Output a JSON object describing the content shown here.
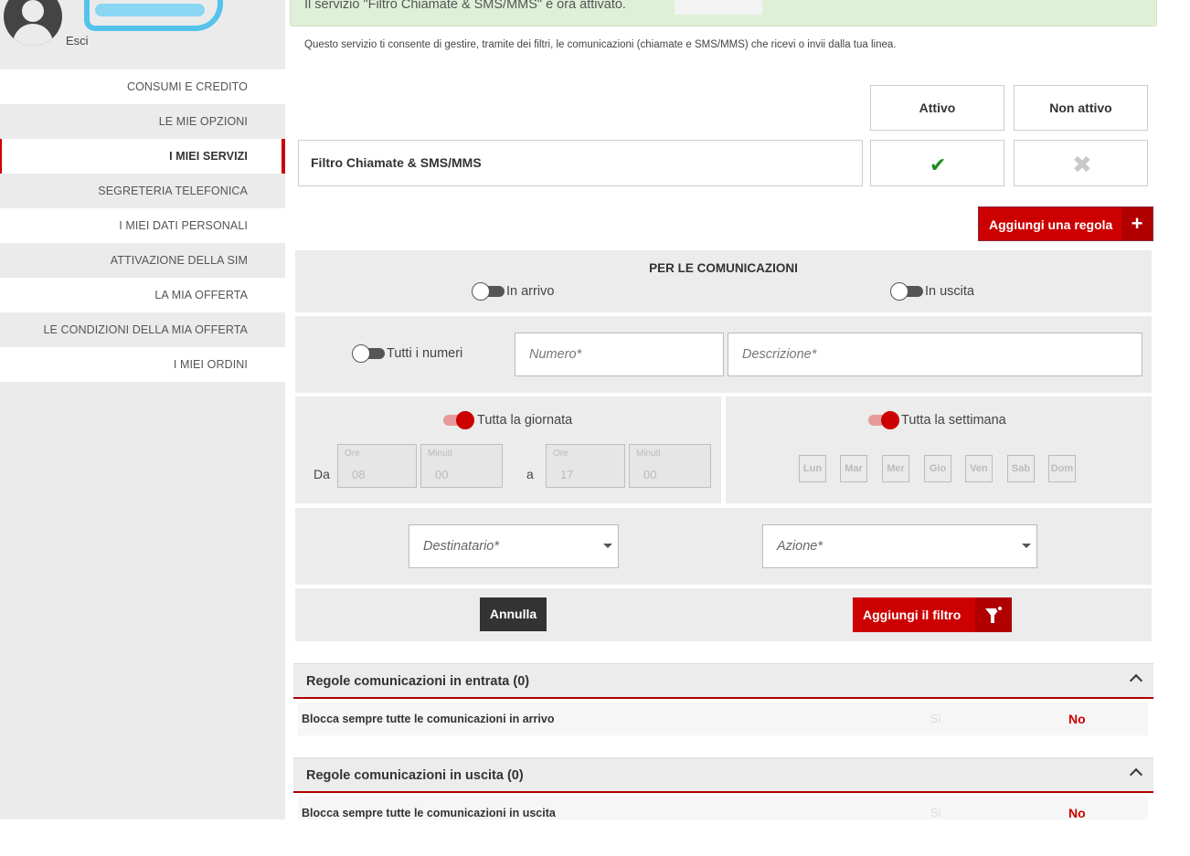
{
  "user": {
    "logout_label": "Esci"
  },
  "banner": {
    "message": "Il servizio \"Filtro Chiamate & SMS/MMS\" è ora attivato."
  },
  "intro_text": "Questo servizio ti consente di gestire, tramite dei filtri, le comunicazioni (chiamate e SMS/MMS) che ricevi o invii dalla tua linea.",
  "sidebar": {
    "items": [
      {
        "label": "CONSUMI E CREDITO"
      },
      {
        "label": "LE MIE OPZIONI"
      },
      {
        "label": "I MIEI SERVIZI",
        "active": true
      },
      {
        "label": "SEGRETERIA TELEFONICA"
      },
      {
        "label": "I MIEI DATI PERSONALI"
      },
      {
        "label": "ATTIVAZIONE DELLA SIM"
      },
      {
        "label": "LA MIA OFFERTA"
      },
      {
        "label": "LE CONDIZIONI DELLA MIA OFFERTA"
      },
      {
        "label": "I MIEI ORDINI"
      }
    ]
  },
  "service_table": {
    "col_active": "Attivo",
    "col_inactive": "Non attivo",
    "service_name": "Filtro Chiamate & SMS/MMS",
    "status": "active"
  },
  "add_rule_button": {
    "label": "Aggiungi una regola",
    "icon": "plus-icon"
  },
  "filter_form": {
    "section_title": "PER LE COMUNICAZIONI",
    "incoming_label": "In arrivo",
    "incoming_on": false,
    "outgoing_label": "In uscita",
    "outgoing_on": false,
    "all_numbers_label": "Tutti i numeri",
    "all_numbers_on": false,
    "number_placeholder": "Numero*",
    "description_placeholder": "Descrizione*",
    "all_day_label": "Tutta la giornata",
    "all_day_on": true,
    "all_week_label": "Tutta la settimana",
    "all_week_on": true,
    "from_label": "Da",
    "to_label": "a",
    "hours_caption": "Ore",
    "minutes_caption": "Minuti",
    "from_hours": "08",
    "from_minutes": "00",
    "to_hours": "17",
    "to_minutes": "00",
    "days": [
      "Lun",
      "Mar",
      "Mer",
      "Gio",
      "Ven",
      "Sab",
      "Dom"
    ],
    "recipient_placeholder": "Destinatario*",
    "action_placeholder": "Azione*",
    "cancel_label": "Annulla",
    "add_filter_label": "Aggiungi il filtro",
    "add_filter_icon": "filter-add-icon"
  },
  "rules_incoming": {
    "title": "Regole comunicazioni in entrata (0)",
    "row_label": "Blocca sempre tutte le comunicazioni in arrivo",
    "yes_label": "Sì",
    "no_label": "No"
  },
  "rules_outgoing": {
    "title": "Regole comunicazioni in uscita (0)",
    "row_label": "Blocca sempre tutte le comunicazioni in uscita",
    "yes_label": "Sì",
    "no_label": "No"
  },
  "colors": {
    "brand_red": "#cc0000",
    "success_green": "#1a8f1a",
    "banner_bg": "#dff0d8"
  }
}
